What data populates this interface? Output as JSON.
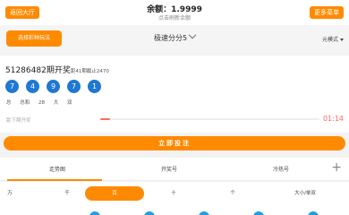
{
  "header": {
    "back_label": "返回大厅",
    "title": "余额：1.9999",
    "subtitle": "点击刷新余额",
    "menu_label": "更多菜单"
  },
  "selector": {
    "button_label": "选择彩种玩法",
    "game_name": "极速分分5",
    "mode_label": "元模式"
  },
  "result": {
    "issue_number": "51286482",
    "issue_suffix": "期开奖",
    "issue_note": "距41期截止2470",
    "balls": [
      "7",
      "4",
      "9",
      "7",
      "1"
    ],
    "stats": [
      "总",
      "总和",
      "28",
      "大",
      "双"
    ],
    "countdown_label": "距下期开奖",
    "progress_percent": 4.5,
    "timer": "01:14"
  },
  "actions": {
    "bet_label": "立即投注"
  },
  "tabs": [
    {
      "label": "走势图"
    },
    {
      "label": "开奖号"
    },
    {
      "label": "冷热号"
    }
  ],
  "filters": [
    {
      "label": "万"
    },
    {
      "label": "千"
    },
    {
      "label": "百"
    },
    {
      "label": "十"
    },
    {
      "label": "个"
    },
    {
      "label": "大小/单双"
    }
  ],
  "colors": {
    "accent": "#ff8a00",
    "ball": "#1f78d1",
    "timer": "#ff6b5f"
  },
  "icons": [
    "chevron-down-icon",
    "plus-icon",
    "triangle-down-icon"
  ]
}
